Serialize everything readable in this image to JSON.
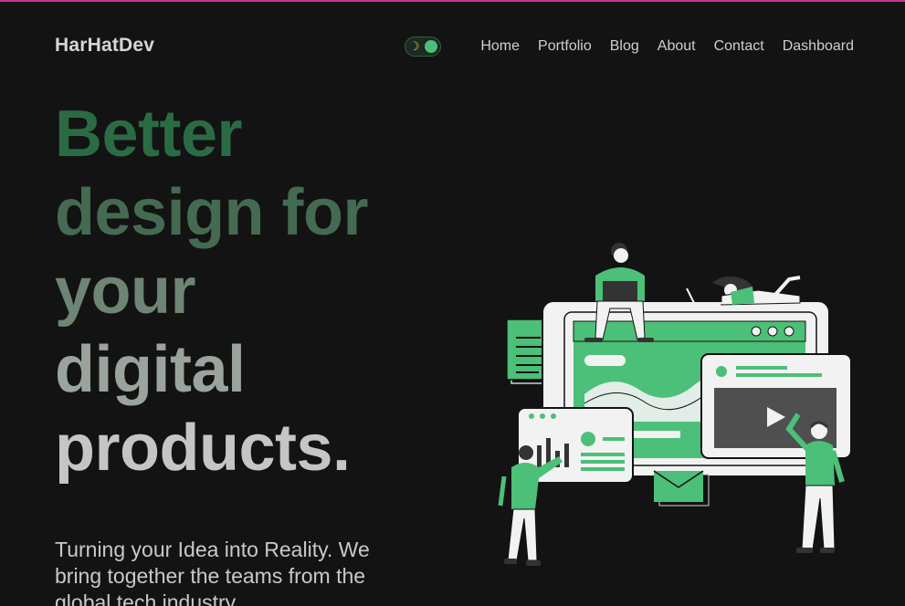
{
  "header": {
    "brand": "HarHatDev",
    "theme_toggle": {
      "moon_glyph": "☽"
    },
    "nav": [
      "Home",
      "Portfolio",
      "Blog",
      "About",
      "Contact",
      "Dashboard"
    ]
  },
  "hero": {
    "headline": [
      "Better",
      "design for",
      "your",
      "digital",
      "products."
    ],
    "subtext": "Turning your Idea into Reality. We bring together the teams from the global tech industry."
  },
  "colors": {
    "background": "#131313",
    "accent_green": "#4cbf78",
    "headline_dark_green": "#2b6b44",
    "text_light": "#c5c5c5",
    "top_border": "#c2378f"
  }
}
